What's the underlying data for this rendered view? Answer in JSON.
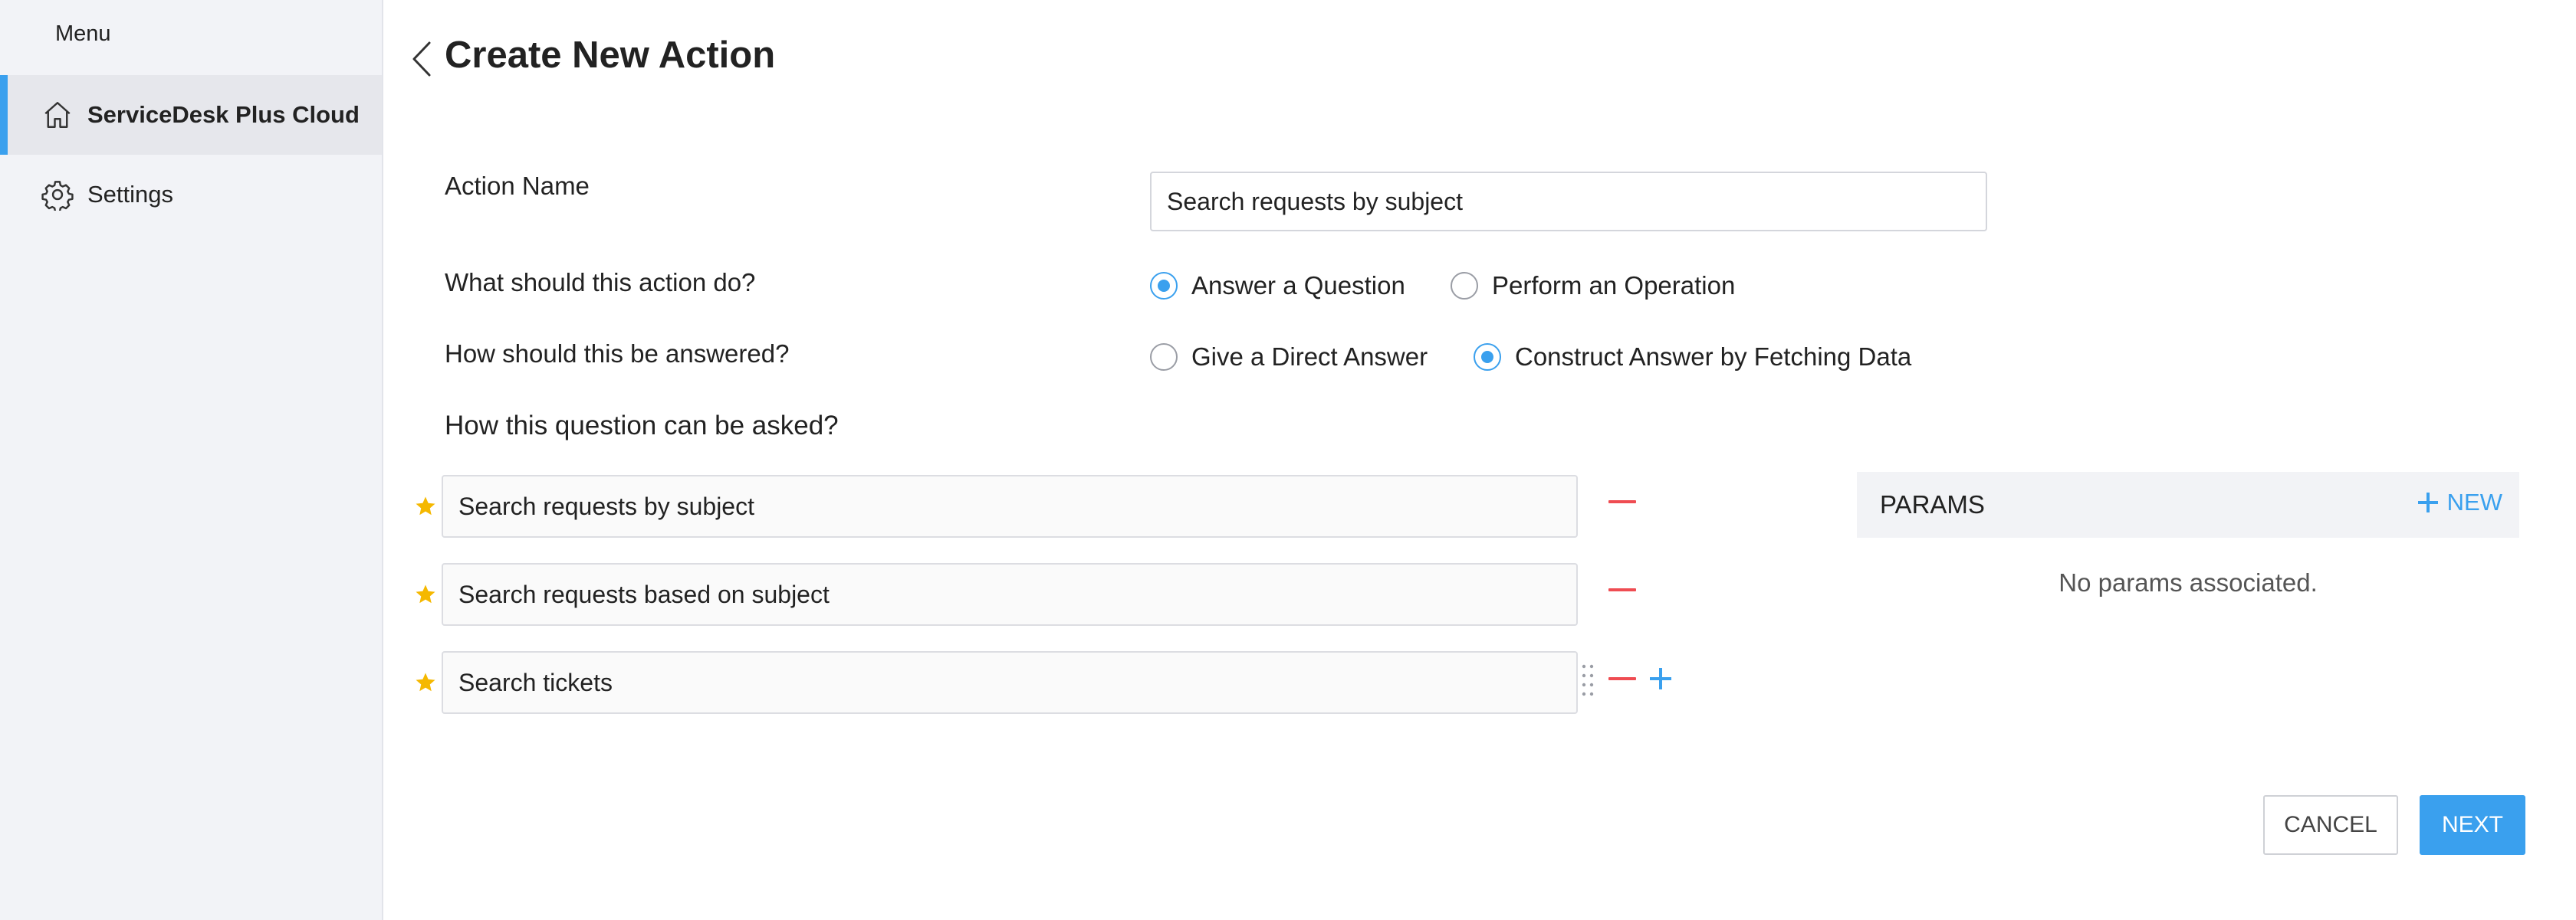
{
  "sidebar": {
    "menu_label": "Menu",
    "items": [
      {
        "label": "ServiceDesk Plus Cloud",
        "icon": "home-icon",
        "active": true
      },
      {
        "label": "Settings",
        "icon": "gear-icon",
        "active": false
      }
    ]
  },
  "page": {
    "title": "Create New Action",
    "back_icon": "chevron-left-icon"
  },
  "form": {
    "action_name_label": "Action Name",
    "action_name_value": "Search requests by subject",
    "action_type_label": "What should this action do?",
    "action_type_options": [
      {
        "label": "Answer a Question",
        "selected": true
      },
      {
        "label": "Perform an Operation",
        "selected": false
      }
    ],
    "answer_type_label": "How should this be answered?",
    "answer_type_options": [
      {
        "label": "Give a Direct Answer",
        "selected": false
      },
      {
        "label": "Construct Answer by Fetching Data",
        "selected": true
      }
    ],
    "questions_label": "How this question can be asked?",
    "questions": [
      "Search requests by subject",
      "Search requests based on subject",
      "Search tickets"
    ]
  },
  "params": {
    "title": "PARAMS",
    "new_label": "NEW",
    "empty_text": "No params associated."
  },
  "footer": {
    "cancel_label": "CANCEL",
    "next_label": "NEXT"
  },
  "colors": {
    "accent": "#3aa0ee",
    "remove": "#ef4c52",
    "star": "#f5b800",
    "sidebar_bg": "#f2f3f7"
  }
}
